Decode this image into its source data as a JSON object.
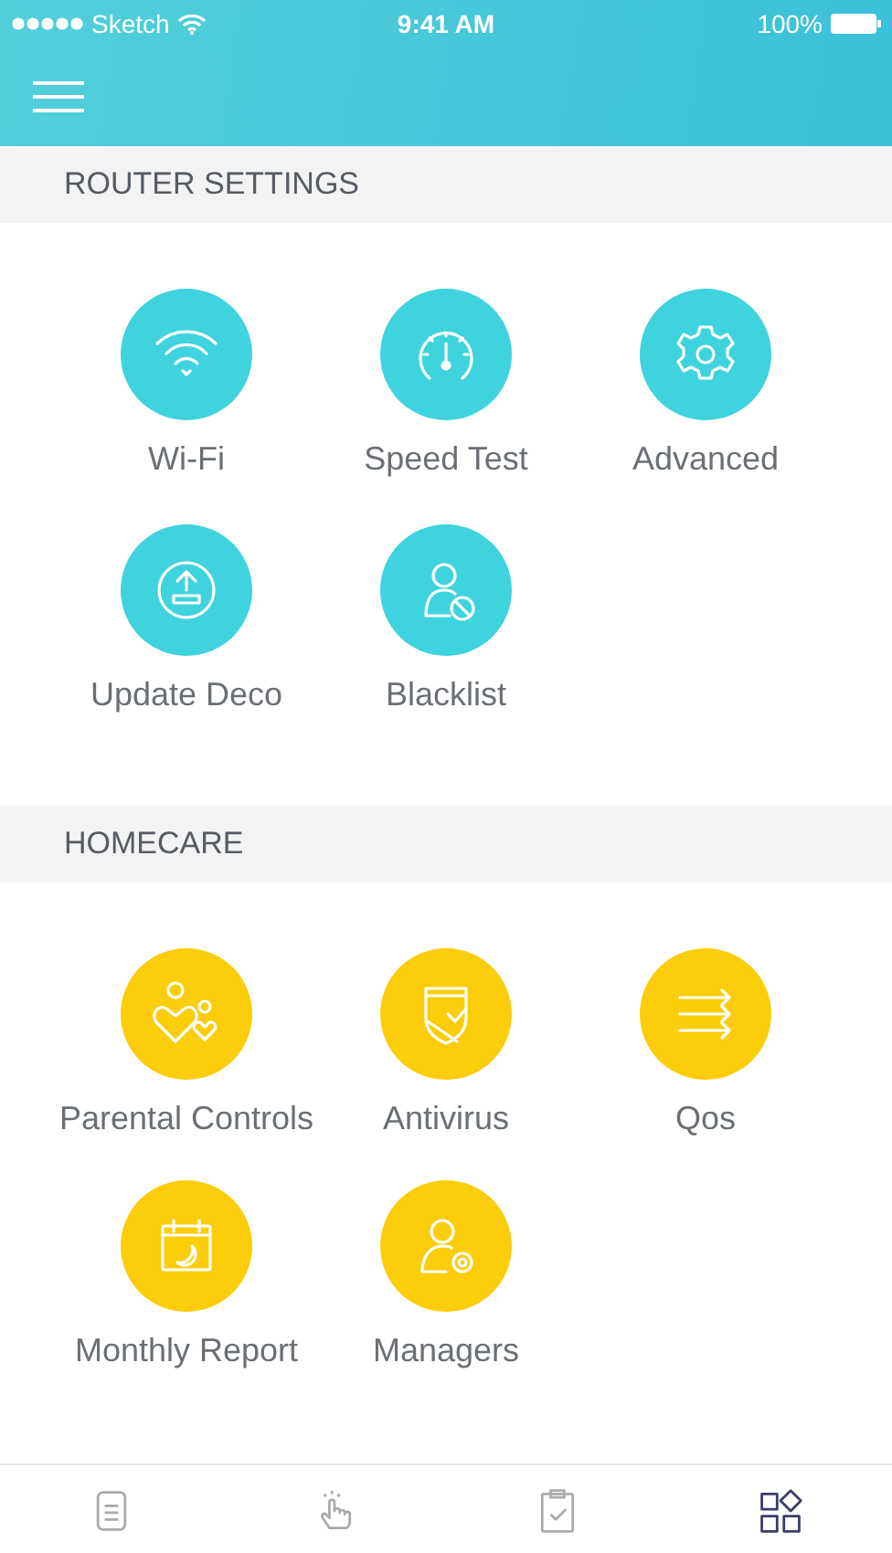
{
  "status_bar": {
    "carrier": "Sketch",
    "time": "9:41 AM",
    "battery": "100%"
  },
  "sections": [
    {
      "title": "ROUTER SETTINGS",
      "kind": "router",
      "items": [
        {
          "label": "Wi-Fi"
        },
        {
          "label": "Speed Test"
        },
        {
          "label": "Advanced"
        },
        {
          "label": "Update Deco"
        },
        {
          "label": "Blacklist"
        }
      ]
    },
    {
      "title": "HOMECARE",
      "kind": "homecare",
      "items": [
        {
          "label": "Parental Controls"
        },
        {
          "label": "Antivirus"
        },
        {
          "label": "Qos"
        },
        {
          "label": "Monthly Report"
        },
        {
          "label": "Managers"
        }
      ]
    }
  ],
  "tab_bar": [
    {
      "selected": false
    },
    {
      "selected": false
    },
    {
      "selected": false
    },
    {
      "selected": true
    }
  ]
}
